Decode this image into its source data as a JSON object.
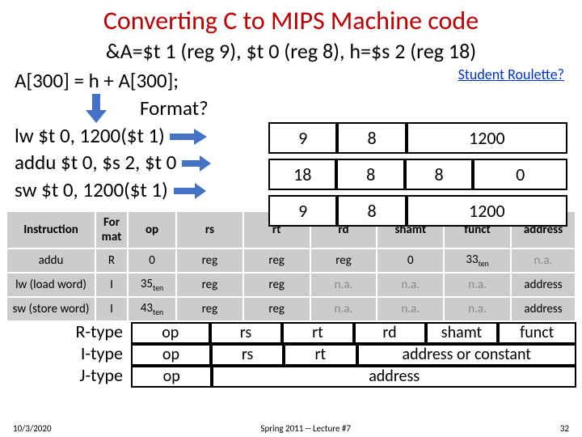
{
  "title": "Converting C to MIPS Machine code",
  "subtitle": "&A=$t 1 (reg 9), $t 0 (reg 8), h=$s 2 (reg 18)",
  "link_text": "Student Roulette?",
  "code": {
    "line1": "A[300] = h + A[300];",
    "format": "Format?",
    "line2": "lw $t 0, 1200($t 1)",
    "line3": "addu $t 0, $s 2, $t 0",
    "line4": "sw $t 0, 1200($t 1)"
  },
  "enc": {
    "r1": {
      "a": "9",
      "b": "8",
      "c": "1200"
    },
    "r2": {
      "a": "18",
      "b": "8",
      "c": "8",
      "d": "0"
    },
    "r3": {
      "a": "9",
      "b": "8",
      "c": "1200"
    }
  },
  "table": {
    "headers": [
      "Instruction",
      "For mat",
      "op",
      "rs",
      "rt",
      "rd",
      "shamt",
      "funct",
      "address"
    ],
    "rows": [
      {
        "name": "addu",
        "fmt": "R",
        "op": "0",
        "rs": "reg",
        "rt": "reg",
        "rd": "reg",
        "shamt": "0",
        "funct": "33",
        "funct_sub": "ten",
        "addr": "n.a."
      },
      {
        "name": "lw (load word)",
        "fmt": "I",
        "op": "35",
        "op_sub": "ten",
        "rs": "reg",
        "rt": "reg",
        "rd": "n.a.",
        "shamt": "n.a.",
        "funct": "n.a.",
        "addr": "address"
      },
      {
        "name": "sw (store word)",
        "fmt": "I",
        "op": "43",
        "op_sub": "ten",
        "rs": "reg",
        "rt": "reg",
        "rd": "n.a.",
        "shamt": "n.a.",
        "funct": "n.a.",
        "addr": "address"
      }
    ]
  },
  "types": {
    "r": {
      "label": "R-type",
      "f": [
        "op",
        "rs",
        "rt",
        "rd",
        "shamt",
        "funct"
      ]
    },
    "i": {
      "label": "I-type",
      "f": [
        "op",
        "rs",
        "rt",
        "address or constant"
      ]
    },
    "j": {
      "label": "J-type",
      "f": [
        "op",
        "address"
      ]
    }
  },
  "footer": {
    "date": "10/3/2020",
    "center": "Spring 2011 -- Lecture #7",
    "page": "32"
  }
}
